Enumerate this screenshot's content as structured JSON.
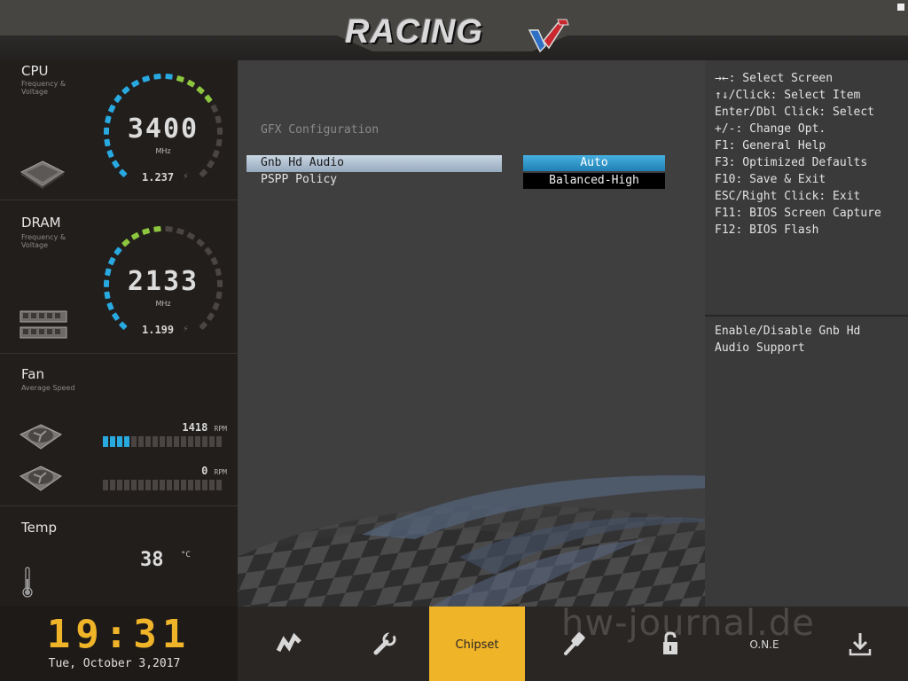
{
  "header": {
    "logo_text": "RACING",
    "logo_colors": {
      "red": "#c8282e",
      "blue": "#2f6fc4"
    }
  },
  "sidebar": {
    "cpu": {
      "title": "CPU",
      "subtitle": "Frequency & Voltage",
      "frequency": "3400",
      "unit": "MHz",
      "voltage": "1.237",
      "gauge_level": 0.72
    },
    "dram": {
      "title": "DRAM",
      "subtitle": "Frequency & Voltage",
      "frequency": "2133",
      "unit": "MHz",
      "voltage": "1.199",
      "gauge_level": 0.5
    },
    "fan": {
      "title": "Fan",
      "subtitle": "Average Speed",
      "fans": [
        {
          "rpm": "1418",
          "unit": "RPM",
          "level_segments": 4,
          "total_segments": 17
        },
        {
          "rpm": "0",
          "unit": "RPM",
          "level_segments": 0,
          "total_segments": 17
        }
      ]
    },
    "temp": {
      "title": "Temp",
      "value": "38",
      "unit": "°C"
    }
  },
  "main": {
    "section_title": "GFX Configuration",
    "options": [
      {
        "label": "Gnb Hd Audio",
        "value": "Auto",
        "selected": true
      },
      {
        "label": "PSPP Policy",
        "value": "Balanced-High",
        "selected": false
      }
    ]
  },
  "help": {
    "keys": [
      "→←: Select Screen",
      "↑↓/Click: Select Item",
      "Enter/Dbl Click: Select",
      "+/-: Change Opt.",
      "F1: General Help",
      "F3: Optimized Defaults",
      "F10: Save & Exit",
      "ESC/Right Click: Exit",
      "F11: BIOS Screen Capture",
      "F12: BIOS Flash"
    ],
    "description": [
      "Enable/Disable Gnb Hd",
      "Audio Support"
    ]
  },
  "footer": {
    "time": "19:31",
    "date": "Tue, October  3,2017",
    "tabs": [
      {
        "label": "",
        "icon": "racing-flag-icon"
      },
      {
        "label": "",
        "icon": "wrench-icon"
      },
      {
        "label": "Chipset",
        "icon": "",
        "active": true
      },
      {
        "label": "",
        "icon": "hammer-icon"
      },
      {
        "label": "",
        "icon": "lock-icon"
      },
      {
        "label": "O.N.E",
        "icon": ""
      },
      {
        "label": "",
        "icon": "download-icon"
      }
    ],
    "watermark": "hw-journal.de",
    "accent": "#f0b429",
    "gauge_colors": {
      "cyan": "#28a9e0",
      "green": "#8cc63f",
      "off": "#4a4542"
    }
  }
}
